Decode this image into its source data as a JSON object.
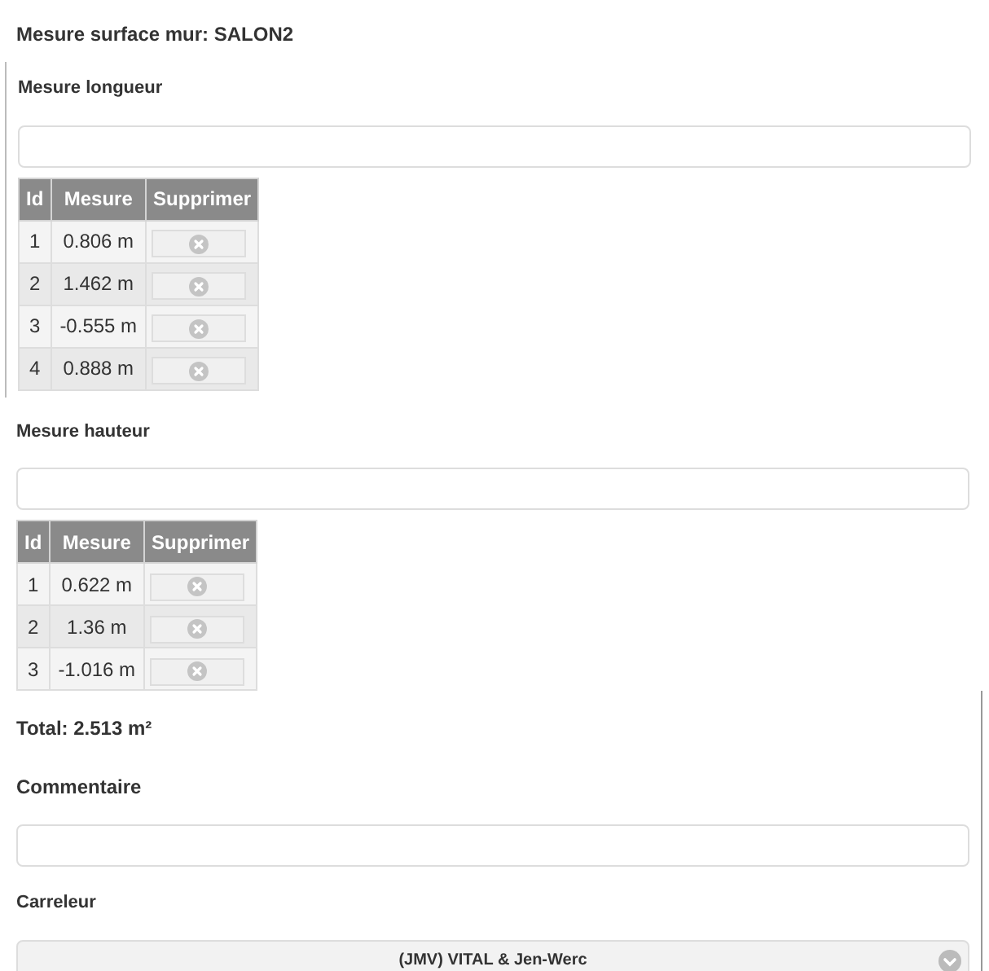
{
  "title": "Mesure surface mur: SALON2",
  "sections": [
    {
      "label": "Mesure longueur",
      "columns": [
        "Id",
        "Mesure",
        "Supprimer"
      ],
      "rows": [
        {
          "id": "1",
          "value": "0.806 m"
        },
        {
          "id": "2",
          "value": "1.462 m"
        },
        {
          "id": "3",
          "value": "-0.555 m"
        },
        {
          "id": "4",
          "value": "0.888 m"
        }
      ]
    },
    {
      "label": "Mesure hauteur",
      "columns": [
        "Id",
        "Mesure",
        "Supprimer"
      ],
      "rows": [
        {
          "id": "1",
          "value": "0.622 m"
        },
        {
          "id": "2",
          "value": "1.36 m"
        },
        {
          "id": "3",
          "value": "-1.016 m"
        }
      ]
    }
  ],
  "total": "Total: 2.513 m²",
  "comment": {
    "label": "Commentaire"
  },
  "tiler": {
    "label": "Carreleur",
    "value": "(JMV) VITAL & Jen-Werc"
  }
}
